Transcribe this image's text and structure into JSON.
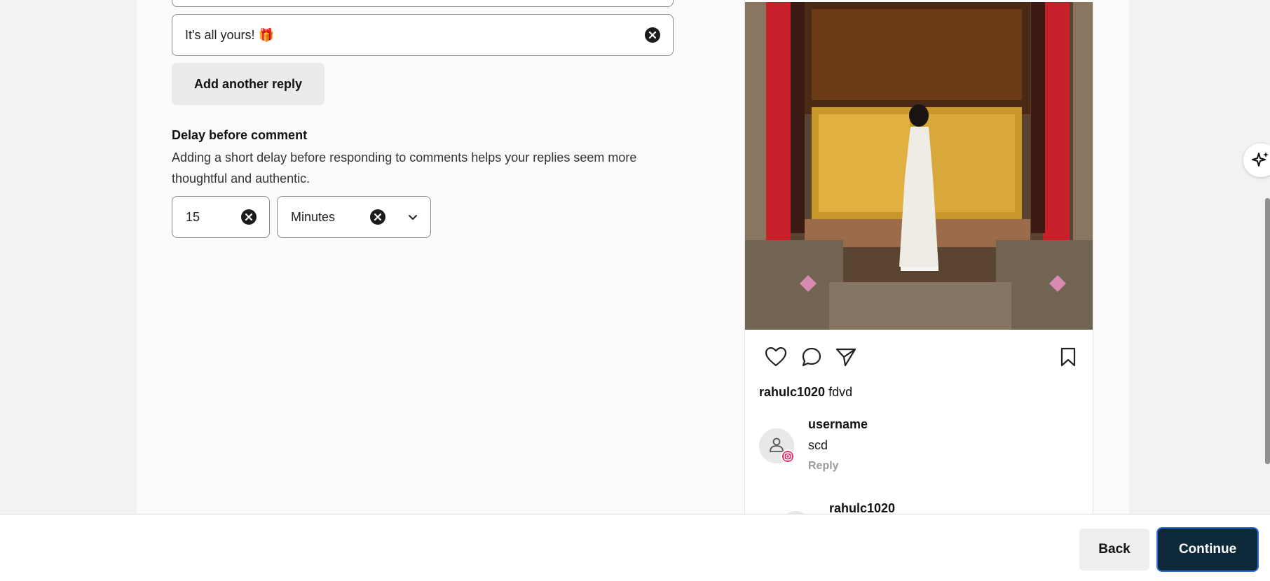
{
  "form": {
    "reply_value": "It's all yours! 🎁",
    "add_reply_label": "Add another reply",
    "delay": {
      "title": "Delay before comment",
      "description": "Adding a short delay before responding to comments helps your replies seem more thoughtful and authentic.",
      "amount": "15",
      "unit": "Minutes"
    }
  },
  "preview": {
    "caption_user": "rahulc1020",
    "caption_text": "fdvd",
    "comments": [
      {
        "user": "username",
        "text": "scd",
        "reply_label": "Reply"
      },
      {
        "user": "rahulc1020"
      }
    ]
  },
  "footer": {
    "back_label": "Back",
    "continue_label": "Continue"
  },
  "colors": {
    "continue_bg": "#0e2a3a",
    "continue_border": "#2d6fd0",
    "instagram_badge": "#d6336c"
  },
  "icons": [
    "clear-icon",
    "chevron-down-icon",
    "heart-icon",
    "comment-icon",
    "share-icon",
    "bookmark-icon",
    "user-icon",
    "instagram-icon",
    "sparkle-icon"
  ]
}
